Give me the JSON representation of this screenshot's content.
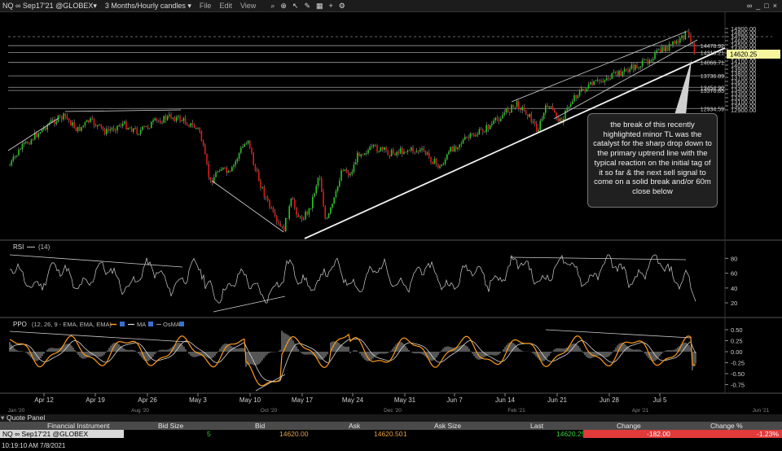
{
  "window": {
    "symbol": "NQ ∞ Sep17'21 @GLOBEX▾",
    "period": "3 Months/Hourly candles ▾",
    "menu": [
      "File",
      "Edit",
      "View"
    ]
  },
  "price_axis": {
    "ticks": [
      "14900.00",
      "14800.00",
      "14700.00",
      "14600.00",
      "14500.00",
      "14400.00",
      "14300.00",
      "14200.00",
      "14100.00",
      "14000.00",
      "13900.00",
      "13800.00",
      "13700.00",
      "13600.00",
      "13500.00",
      "13400.00",
      "13300.00",
      "13200.00",
      "13100.00",
      "13000.00",
      "12900.00"
    ],
    "current": "14620.25",
    "levels": [
      "14478.92",
      "14313.21",
      "14066.71",
      "13736.89",
      "13454.90",
      "13376.85",
      "12934.59"
    ]
  },
  "rsi": {
    "label": "RSI",
    "params": "(14)",
    "ticks": [
      "80",
      "60",
      "40",
      "20"
    ]
  },
  "ppo": {
    "label": "PPO",
    "params": "(12, 26, 9 - EMA, EMA, EMA)",
    "ma_label": "MA",
    "osma_label": "OsMA",
    "ticks": [
      "0.50",
      "0.25",
      "0.00",
      "-0.25",
      "-0.50",
      "-0.75"
    ]
  },
  "date_axis": {
    "labels": [
      "Apr 12",
      "Apr 19",
      "Apr 26",
      "May 3",
      "May 10",
      "May 17",
      "May 24",
      "May 31",
      "Jun 7",
      "Jun 14",
      "Jun 21",
      "Jun 28",
      "Jul 5"
    ],
    "secondary": [
      "Jan '20",
      "Aug '20",
      "Oct '20",
      "Dec '20",
      "Feb '21",
      "Apr '21",
      "Jun '21"
    ]
  },
  "annotation": "the break of this recently highlighted minor TL was the catalyst for the sharp drop down to the primary uptrend line with the typical reaction on the initial tag of it so far & the next sell signal to come on a solid break and/or 60m close below",
  "quote_panel": {
    "title": "Quote Panel",
    "columns": [
      "Financial Instrument",
      "Bid Size",
      "Bid",
      "Ask",
      "Ask Size",
      "Last",
      "Change",
      "Change %"
    ],
    "row": {
      "instrument": "NQ ∞ Sep17'21 @GLOBEX",
      "bid_size": "5",
      "bid": "14620.00",
      "ask": "14620.50",
      "ask_size": "1",
      "last": "14620.25",
      "change": "-182.00",
      "change_pct": "-1.23%"
    }
  },
  "status": "10:19:10 AM 7/8/2021",
  "colors": {
    "up": "#22c81e",
    "down": "#e01818",
    "ppo": "#ff9c1a",
    "ma": "#d8d8d8",
    "note_bg": "#202020",
    "change_bg": "#e03a3a"
  }
}
